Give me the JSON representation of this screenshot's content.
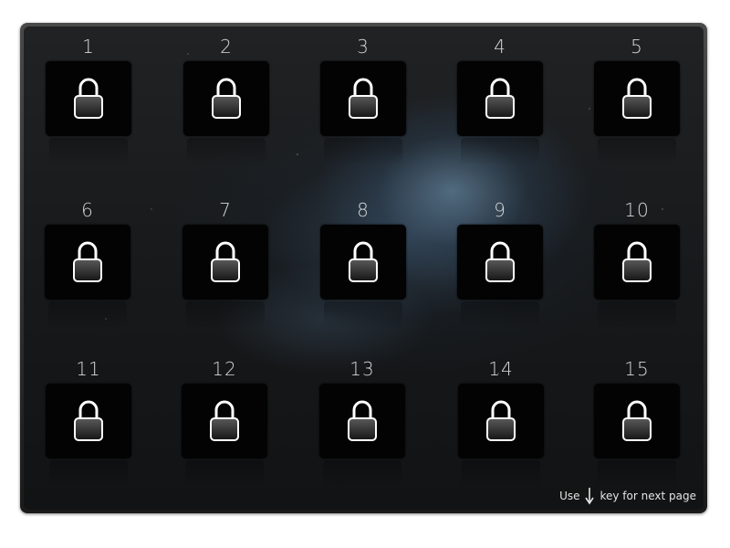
{
  "levels": [
    {
      "number": "1",
      "icon": "lock-icon",
      "locked": true
    },
    {
      "number": "2",
      "icon": "lock-icon",
      "locked": true
    },
    {
      "number": "3",
      "icon": "lock-icon",
      "locked": true
    },
    {
      "number": "4",
      "icon": "lock-icon",
      "locked": true
    },
    {
      "number": "5",
      "icon": "lock-icon",
      "locked": true
    },
    {
      "number": "6",
      "icon": "lock-icon",
      "locked": true
    },
    {
      "number": "7",
      "icon": "lock-icon",
      "locked": true
    },
    {
      "number": "8",
      "icon": "lock-icon",
      "locked": true
    },
    {
      "number": "9",
      "icon": "lock-icon",
      "locked": true
    },
    {
      "number": "10",
      "icon": "lock-icon",
      "locked": true
    },
    {
      "number": "11",
      "icon": "lock-icon",
      "locked": true
    },
    {
      "number": "12",
      "icon": "lock-icon",
      "locked": true
    },
    {
      "number": "13",
      "icon": "lock-icon",
      "locked": true
    },
    {
      "number": "14",
      "icon": "lock-icon",
      "locked": true
    },
    {
      "number": "15",
      "icon": "lock-icon",
      "locked": true
    }
  ],
  "footer": {
    "hint_prefix": "Use",
    "hint_icon": "down-arrow-icon",
    "hint_suffix": "key for next page"
  },
  "colors": {
    "tile_background": "#030303",
    "lock_stroke": "#ffffff",
    "text": "#d8d8d8"
  }
}
